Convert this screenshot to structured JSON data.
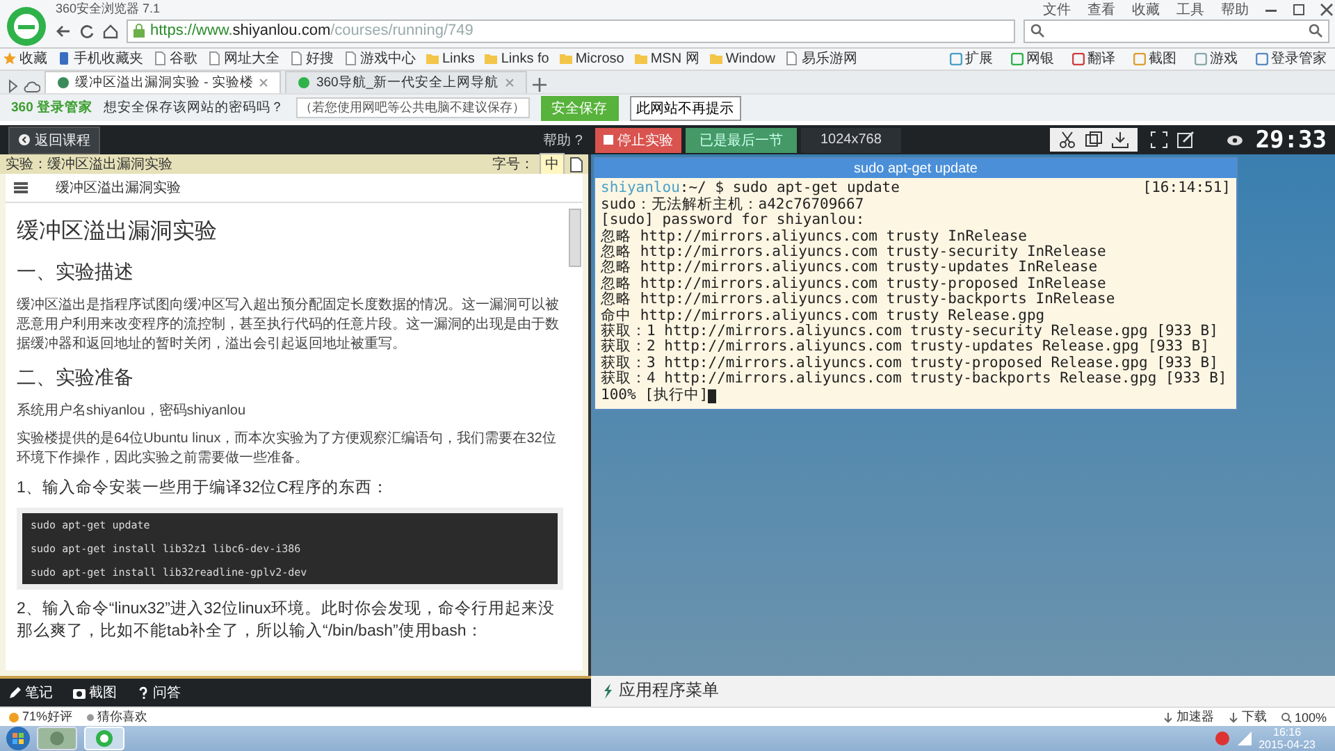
{
  "browser": {
    "title": "360安全浏览器 7.1",
    "menu": [
      "文件",
      "查看",
      "收藏",
      "工具",
      "帮助"
    ],
    "url": {
      "scheme": "https://www.",
      "domain": "shiyanlou.com",
      "path": "/courses/running/749"
    },
    "bookmarks": [
      {
        "label": "收藏",
        "kind": "star"
      },
      {
        "label": "手机收藏夹",
        "kind": "phone"
      },
      {
        "label": "谷歌",
        "kind": "page"
      },
      {
        "label": "网址大全",
        "kind": "page"
      },
      {
        "label": "好搜",
        "kind": "page"
      },
      {
        "label": "游戏中心",
        "kind": "page"
      },
      {
        "label": "Links",
        "kind": "folder"
      },
      {
        "label": "Links fo",
        "kind": "folder"
      },
      {
        "label": "Microso",
        "kind": "folder"
      },
      {
        "label": "MSN 网",
        "kind": "folder"
      },
      {
        "label": "Window",
        "kind": "folder"
      },
      {
        "label": "易乐游网",
        "kind": "page"
      }
    ],
    "extensions": [
      "扩展",
      "网银",
      "翻译",
      "截图",
      "游戏",
      "登录管家"
    ],
    "tabs": [
      {
        "label": "缓冲区溢出漏洞实验 - 实验楼",
        "selected": true
      },
      {
        "label": "360导航_新一代安全上网导航",
        "selected": false
      }
    ],
    "password_bar": {
      "brand": "360 登录管家",
      "question": "想安全保存该网站的密码吗？",
      "hint": "（若您使用网吧等公共电脑不建议保存）",
      "save_button": "安全保存",
      "never_button": "此网站不再提示"
    }
  },
  "lab": {
    "back_button": "返回课程",
    "help": "帮助 ?",
    "stop_button": "停止实验",
    "last_button": "已是最后一节",
    "resolution": "1024x768",
    "timer": "29:33",
    "header": "实验：缓冲区溢出漏洞实验",
    "font_label": "字号：",
    "font_size": "中",
    "section": "缓冲区溢出漏洞实验",
    "content": [
      {
        "kind": "h1",
        "text": "缓冲区溢出漏洞实验"
      },
      {
        "kind": "h2",
        "text": "一、实验描述"
      },
      {
        "kind": "p",
        "text": "缓冲区溢出是指程序试图向缓冲区写入超出预分配固定长度数据的情况。这一漏洞可以被恶意用户利用来改变程序的流控制，甚至执行代码的任意片段。这一漏洞的出现是由于数据缓冲器和返回地址的暂时关闭，溢出会引起返回地址被重写。"
      },
      {
        "kind": "h2",
        "text": "二、实验准备"
      },
      {
        "kind": "p",
        "text": "系统用户名shiyanlou，密码shiyanlou"
      },
      {
        "kind": "p",
        "text": "实验楼提供的是64位Ubuntu linux，而本次实验为了方便观察汇编语句，我们需要在32位环境下作操作，因此实验之前需要做一些准备。"
      },
      {
        "kind": "h3",
        "text": "1、输入命令安装一些用于编译32位C程序的东西："
      },
      {
        "kind": "code",
        "lines": [
          "sudo apt-get update",
          "sudo apt-get install lib32z1 libc6-dev-i386",
          "sudo apt-get install lib32readline-gplv2-dev"
        ]
      },
      {
        "kind": "h3",
        "text": "2、输入命令“linux32”进入32位linux环境。此时你会发现，命令行用起来没那么爽了，比如不能tab补全了，所以输入“/bin/bash”使用bash："
      }
    ],
    "bottom_tabs": [
      {
        "label": "笔记",
        "kind": "pencil"
      },
      {
        "label": "截图",
        "kind": "camera"
      },
      {
        "label": "问答",
        "kind": "question"
      }
    ]
  },
  "terminal": {
    "title": "sudo apt-get update",
    "user": "shiyanlou",
    "command": ":~/ $ sudo apt-get update",
    "time": "[16:14:51]",
    "lines": [
      "sudo：无法解析主机：a42c76709667",
      "[sudo] password for shiyanlou:",
      "忽略 http://mirrors.aliyuncs.com trusty InRelease",
      "忽略 http://mirrors.aliyuncs.com trusty-security InRelease",
      "忽略 http://mirrors.aliyuncs.com trusty-updates InRelease",
      "忽略 http://mirrors.aliyuncs.com trusty-proposed InRelease",
      "忽略 http://mirrors.aliyuncs.com trusty-backports InRelease",
      "命中 http://mirrors.aliyuncs.com trusty Release.gpg",
      "获取：1 http://mirrors.aliyuncs.com trusty-security Release.gpg [933 B]",
      "获取：2 http://mirrors.aliyuncs.com trusty-updates Release.gpg [933 B]",
      "获取：3 http://mirrors.aliyuncs.com trusty-proposed Release.gpg [933 B]",
      "获取：4 http://mirrors.aliyuncs.com trusty-backports Release.gpg [933 B]",
      "100% [执行中]"
    ]
  },
  "desktop_menu": "应用程序菜单",
  "status_bar": {
    "rating": "71%好评",
    "recommend": "猜你喜欢",
    "tools": [
      "加速器",
      "下载"
    ],
    "zoom": "100%"
  },
  "taskbar": {
    "time": "16:16",
    "date": "2015-04-23"
  }
}
